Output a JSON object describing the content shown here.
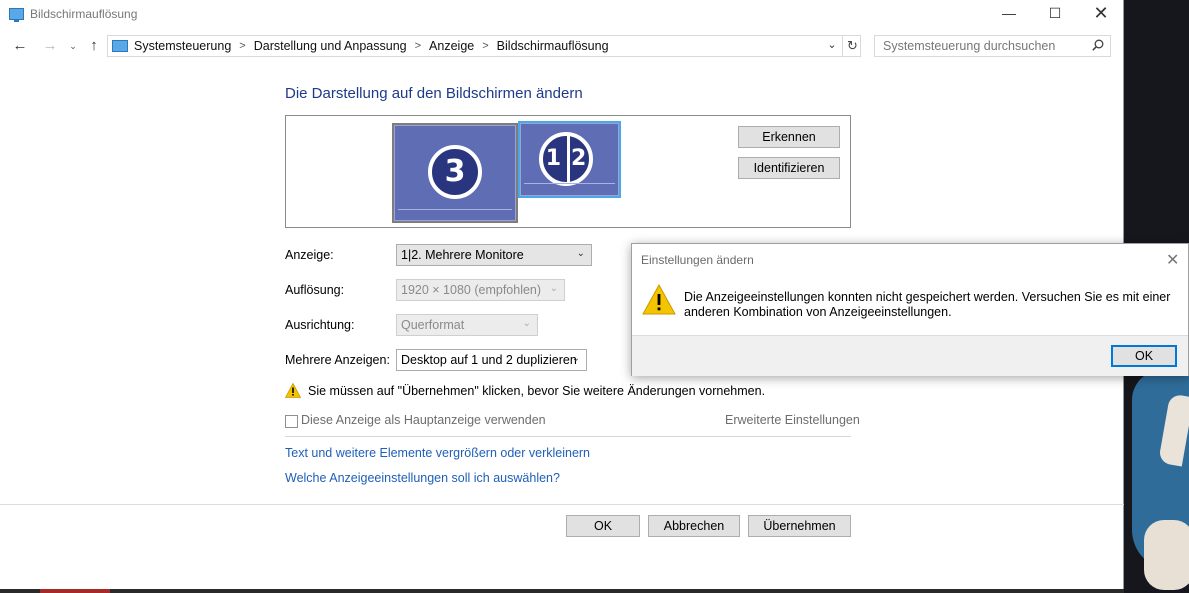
{
  "window": {
    "title": "Bildschirmauflösung",
    "minimize_glyph": "—",
    "maximize_glyph": "☐",
    "close_glyph": "✕"
  },
  "nav": {
    "back_glyph": "←",
    "forward_glyph": "→",
    "recent_glyph": "⌄",
    "up_glyph": "↑",
    "breadcrumb": [
      "Systemsteuerung",
      "Darstellung und Anpassung",
      "Anzeige",
      "Bildschirmauflösung"
    ],
    "breadcrumb_sep": ">",
    "dropdown_glyph": "⌄",
    "refresh_glyph": "↻",
    "search_placeholder": "Systemsteuerung durchsuchen"
  },
  "main": {
    "title": "Die Darstellung auf den Bildschirmen ändern",
    "monitors": {
      "left_label": "3",
      "right_left_label": "1",
      "right_right_label": "2"
    },
    "detect_button": "Erkennen",
    "identify_button": "Identifizieren",
    "fields": {
      "display_label": "Anzeige:",
      "display_value": "1|2. Mehrere Monitore",
      "resolution_label": "Auflösung:",
      "resolution_value": "1920 × 1080 (empfohlen)",
      "orientation_label": "Ausrichtung:",
      "orientation_value": "Querformat",
      "multi_label": "Mehrere Anzeigen:",
      "multi_value": "Desktop auf 1 und 2 duplizieren"
    },
    "chevron": "⌄",
    "warning_text": "Sie müssen auf \"Übernehmen\" klicken, bevor Sie weitere Änderungen vornehmen.",
    "primary_checkbox_label": "Diese Anzeige als Hauptanzeige verwenden",
    "advanced_link": "Erweiterte Einstellungen",
    "link_scale": "Text und weitere Elemente vergrößern oder verkleinern",
    "link_help": "Welche Anzeigeeinstellungen soll ich auswählen?",
    "ok_button": "OK",
    "cancel_button": "Abbrechen",
    "apply_button": "Übernehmen"
  },
  "dialog": {
    "title": "Einstellungen ändern",
    "close_glyph": "✕",
    "message": "Die Anzeigeeinstellungen konnten nicht gespeichert werden. Versuchen Sie es mit einer anderen Kombination von Anzeigeeinstellungen.",
    "ok_button": "OK"
  },
  "colors": {
    "title_blue": "#1e3a8a",
    "link_blue": "#1f5fb8",
    "monitor_fill": "#5f6eb4",
    "selected_border": "#4aa8e8",
    "warning_yellow": "#f5c400"
  },
  "icons": {
    "app": "monitor-icon",
    "warning": "warning-icon",
    "search": "search-icon"
  }
}
